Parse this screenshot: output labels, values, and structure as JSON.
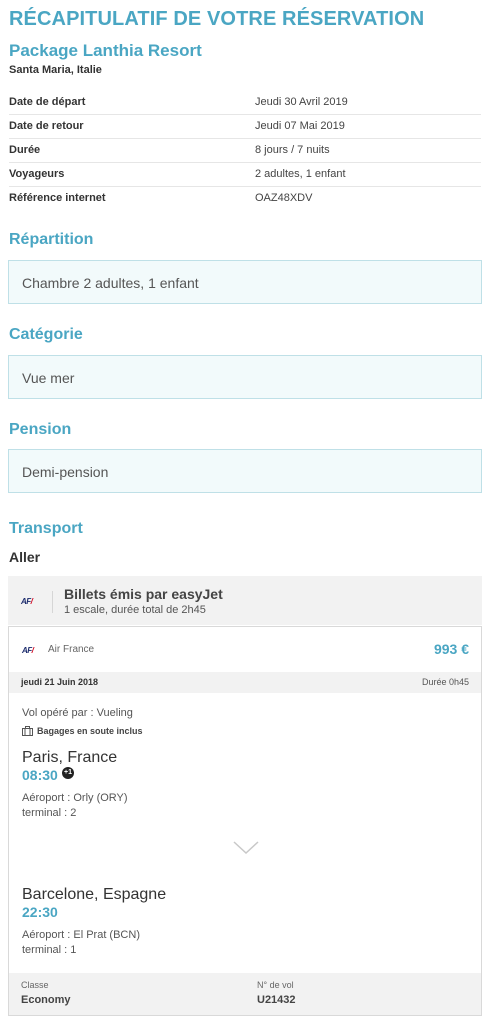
{
  "summary": {
    "title": "RÉCAPITULATIF DE VOTRE RÉSERVATION",
    "package_name": "Package Lanthia Resort",
    "location": "Santa Maria, Italie"
  },
  "details": [
    {
      "label": "Date de départ",
      "value": "Jeudi 30 Avril 2019"
    },
    {
      "label": "Date de retour",
      "value": "Jeudi 07 Mai 2019"
    },
    {
      "label": "Durée",
      "value": "8 jours / 7 nuits"
    },
    {
      "label": "Voyageurs",
      "value": "2 adultes, 1 enfant"
    },
    {
      "label": "Référence internet",
      "value": "OAZ48XDV"
    }
  ],
  "repartition": {
    "title": "Répartition",
    "value": "Chambre 2 adultes, 1 enfant"
  },
  "categorie": {
    "title": "Catégorie",
    "value": "Vue mer"
  },
  "pension": {
    "title": "Pension",
    "value": "Demi-pension"
  },
  "transport": {
    "title": "Transport",
    "direction": "Aller",
    "header": {
      "logo_text": "AF",
      "tickets_title": "Billets émis par easyJet",
      "tickets_subtitle": "1 escale, durée total de 2h45"
    },
    "flight": {
      "airline": "Air France",
      "price": "993 €",
      "date": "jeudi 21 Juin 2018",
      "duration": "Durée 0h45",
      "operated_by": "Vol opéré par : Vueling",
      "baggage": "Bagages en soute inclus",
      "departure": {
        "city": "Paris, France",
        "time": "08:30",
        "day_offset": "+1",
        "airport": "Aéroport : Orly (ORY)",
        "terminal": "terminal : 2"
      },
      "arrival": {
        "city": "Barcelone, Espagne",
        "time": "22:30",
        "airport": "Aéroport : El Prat (BCN)",
        "terminal": "terminal : 1"
      },
      "class_label": "Classe",
      "class_value": "Economy",
      "flight_no_label": "N° de vol",
      "flight_no_value": "U21432"
    }
  },
  "colors": {
    "accent": "#4aa6c3",
    "box_bg": "#f2fafb",
    "box_border": "#bfe0e7",
    "band_bg": "#f2f2f2"
  },
  "icons": [
    "airline-logo-icon",
    "baggage-icon",
    "plus-one-day-icon",
    "chevron-down-icon"
  ]
}
